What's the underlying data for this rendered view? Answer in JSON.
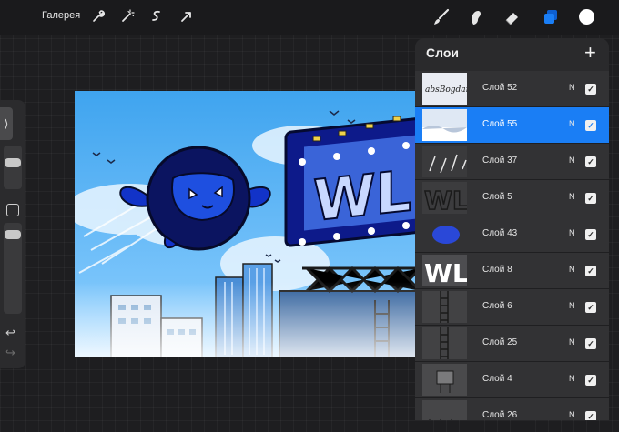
{
  "toolbar": {
    "gallery_label": "Галерея",
    "left_tools": [
      "wrench-icon",
      "magic-wand-icon",
      "selection-icon",
      "transform-arrow-icon"
    ],
    "right_tools": [
      "brush-icon",
      "smudge-icon",
      "eraser-icon",
      "layers-icon"
    ],
    "current_color": "#ffffff",
    "accent_color": "#1a7ef5"
  },
  "sidebar": {
    "expand_glyph": "⟩",
    "undo_glyph": "↩",
    "redo_glyph": "↪"
  },
  "layers_panel": {
    "title": "Слои",
    "add_glyph": "+",
    "layers": [
      {
        "name": "Слой 52",
        "blend": "N",
        "visible": true,
        "active": false,
        "thumb": "handwriting",
        "thumb_text": "absBogdan"
      },
      {
        "name": "Слой 55",
        "blend": "N",
        "visible": true,
        "active": true,
        "thumb": "clouds"
      },
      {
        "name": "Слой 37",
        "blend": "N",
        "visible": true,
        "active": false,
        "thumb": "streaks"
      },
      {
        "name": "Слой 5",
        "blend": "N",
        "visible": true,
        "active": false,
        "thumb": "wl-outline",
        "thumb_text": "WL"
      },
      {
        "name": "Слой 43",
        "blend": "N",
        "visible": true,
        "active": false,
        "thumb": "blue-blob"
      },
      {
        "name": "Слой 8",
        "blend": "N",
        "visible": true,
        "active": false,
        "thumb": "wl-white",
        "thumb_text": "WL"
      },
      {
        "name": "Слой 6",
        "blend": "N",
        "visible": true,
        "active": false,
        "thumb": "ladder"
      },
      {
        "name": "Слой 25",
        "blend": "N",
        "visible": true,
        "active": false,
        "thumb": "ladder"
      },
      {
        "name": "Слой 4",
        "blend": "N",
        "visible": true,
        "active": false,
        "thumb": "billboard"
      },
      {
        "name": "Слой 26",
        "blend": "N",
        "visible": true,
        "active": false,
        "thumb": "truss"
      }
    ]
  },
  "artwork": {
    "billboard_text": "WL"
  }
}
